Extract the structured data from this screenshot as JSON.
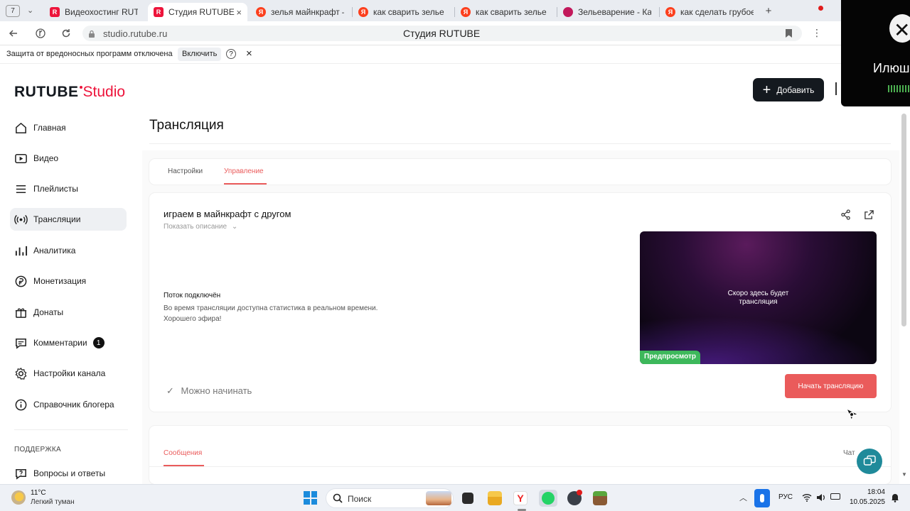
{
  "browser": {
    "tab_count": "7",
    "tabs": [
      {
        "title": "Видеохостинг RUTUBE",
        "active": false
      },
      {
        "title": "Студия RUTUBE",
        "active": true
      },
      {
        "title": "зелья майнкрафт — Я",
        "active": false
      },
      {
        "title": "как сварить зелье силы",
        "active": false
      },
      {
        "title": "как сварить зелье силы",
        "active": false
      },
      {
        "title": "Зельеварение - Как с",
        "active": false
      },
      {
        "title": "как сделать грубое зе",
        "active": false
      }
    ],
    "new_tab": "+",
    "url": "studio.rutube.ru",
    "page_title": "Студия RUTUBE",
    "warning_text": "Защита от вредоносных программ отключена",
    "warning_button": "Включить",
    "warning_help": "?",
    "warning_close": "×"
  },
  "overlay": {
    "name_partial": "Илюш"
  },
  "header": {
    "logo_main": "RUTUBE",
    "logo_sub": "Studio",
    "add_button": "Добавить"
  },
  "sidebar": {
    "items": [
      {
        "label": "Главная",
        "icon": "home-icon"
      },
      {
        "label": "Видео",
        "icon": "video-icon"
      },
      {
        "label": "Плейлисты",
        "icon": "playlist-icon"
      },
      {
        "label": "Трансляции",
        "icon": "broadcast-icon",
        "active": true
      },
      {
        "label": "Аналитика",
        "icon": "analytics-icon"
      },
      {
        "label": "Монетизация",
        "icon": "money-icon"
      },
      {
        "label": "Донаты",
        "icon": "donate-icon"
      },
      {
        "label": "Комментарии",
        "icon": "comment-icon",
        "badge": "1"
      },
      {
        "label": "Настройки канала",
        "icon": "gear-icon"
      },
      {
        "label": "Справочник блогера",
        "icon": "info-icon"
      }
    ],
    "support_heading": "ПОДДЕРЖКА",
    "support_items": [
      {
        "label": "Вопросы и ответы",
        "icon": "question-icon"
      }
    ]
  },
  "main": {
    "page_title": "Трансляция",
    "tabs": [
      {
        "label": "Настройки",
        "active": false
      },
      {
        "label": "Управление",
        "active": true
      }
    ],
    "stream": {
      "title": "играем в майнкрафт с другом",
      "show_description": "Показать описание",
      "status_title": "Поток подключён",
      "status_text_1": "Во время трансляции доступна статистика в реальном времени.",
      "status_text_2": "Хорошего эфира!",
      "ready_label": "Можно начинать",
      "preview_text_1": "Скоро здесь будет",
      "preview_text_2": "трансляция",
      "preview_badge": "Предпросмотр",
      "start_button": "Начать трансляцию"
    },
    "bottom_tabs": [
      {
        "label": "Сообщения",
        "active": true
      },
      {
        "label": "Чат",
        "active": false
      }
    ]
  },
  "taskbar": {
    "temperature": "11°C",
    "weather": "Легкий туман",
    "search_placeholder": "Поиск",
    "language": "РУС",
    "time": "18:04",
    "date": "10.05.2025"
  },
  "colors": {
    "accent_red": "#ea5b5b",
    "rutube_red": "#ed143b",
    "preview_green": "#3db85b",
    "dark_button": "#14191f"
  }
}
